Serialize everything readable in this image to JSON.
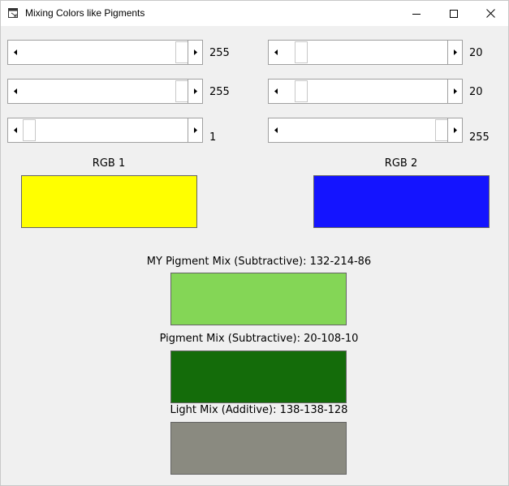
{
  "window": {
    "title": "Mixing Colors like Pigments"
  },
  "sliders": [
    {
      "name": "r1",
      "value": "255",
      "fraction": 1.0
    },
    {
      "name": "g1",
      "value": "255",
      "fraction": 1.0
    },
    {
      "name": "b1",
      "value": "1",
      "fraction": 0.0039
    },
    {
      "name": "r2",
      "value": "20",
      "fraction": 0.0784
    },
    {
      "name": "g2",
      "value": "20",
      "fraction": 0.0784
    },
    {
      "name": "b2",
      "value": "255",
      "fraction": 1.0
    }
  ],
  "rgb1": {
    "label": "RGB 1",
    "color": "#ffff00"
  },
  "rgb2": {
    "label": "RGB 2",
    "color": "#1414ff"
  },
  "mixes": {
    "my_pigment": {
      "label": "MY Pigment Mix (Subtractive): 132-214-86",
      "color": "#84d656"
    },
    "pigment": {
      "label": "Pigment Mix (Subtractive): 20-108-10",
      "color": "#146c0a"
    },
    "light": {
      "label": "Light Mix (Additive): 138-138-128",
      "color": "#8a8a80"
    }
  }
}
